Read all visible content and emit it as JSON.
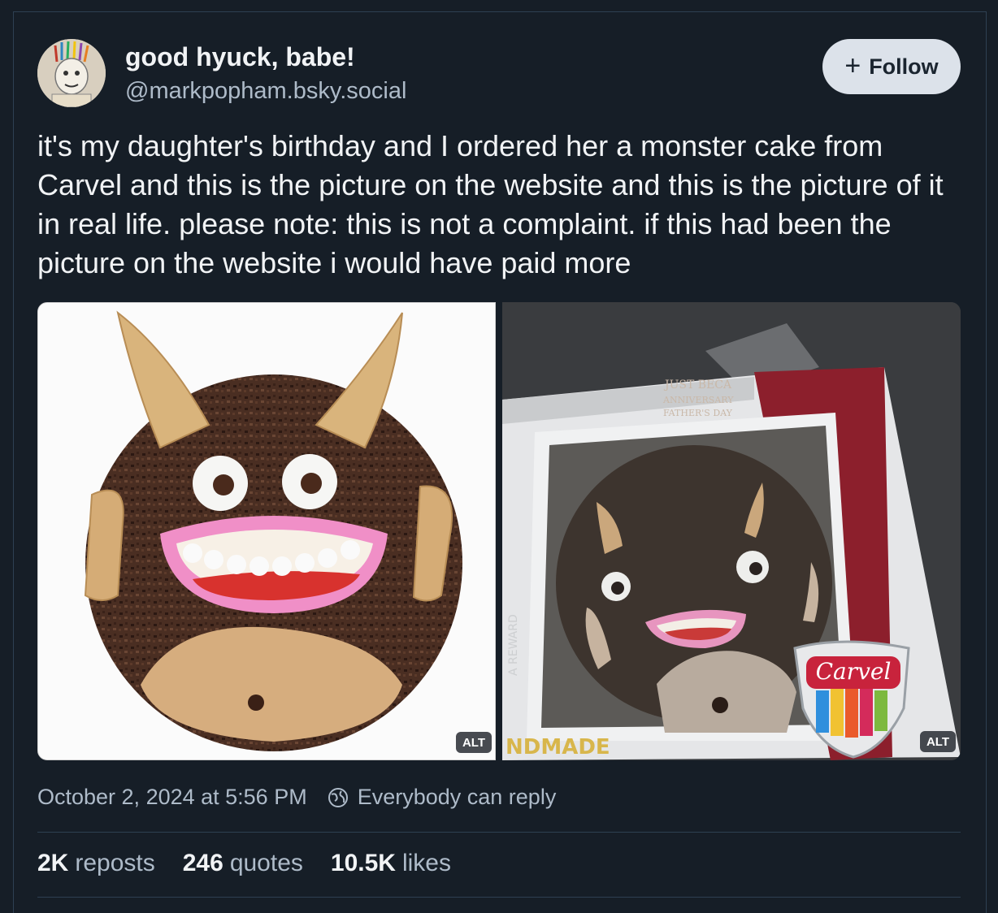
{
  "post": {
    "author": {
      "display_name": "good hyuck, babe!",
      "handle": "@markpopham.bsky.social"
    },
    "follow_label": "Follow",
    "text": "it's my daughter's birthday and I ordered her a monster cake from Carvel and this is the picture on the website and this is the picture of it in real life. please note: this is not a complaint. if this had been the picture on the website i would have paid more",
    "images": [
      {
        "alt_badge": "ALT"
      },
      {
        "alt_badge": "ALT",
        "box_text": {
          "brand": "Carvel",
          "banner_line1": "JUST BECA",
          "banner_line2": "ANNIVERSARY",
          "banner_line3": "FATHER'S DAY",
          "side_text": "A REWARD",
          "bottom_text": "NDMADE"
        }
      }
    ],
    "timestamp": "October 2, 2024 at 5:56 PM",
    "reply_setting": "Everybody can reply",
    "stats": {
      "reposts_count": "2K",
      "reposts_label": "reposts",
      "quotes_count": "246",
      "quotes_label": "quotes",
      "likes_count": "10.5K",
      "likes_label": "likes"
    }
  },
  "colors": {
    "background": "#161e27",
    "secondary_text": "#aebbc9",
    "follow_button_bg": "#dce2ea"
  },
  "icons": {
    "follow": "plus-icon",
    "reply_setting": "globe-icon"
  }
}
